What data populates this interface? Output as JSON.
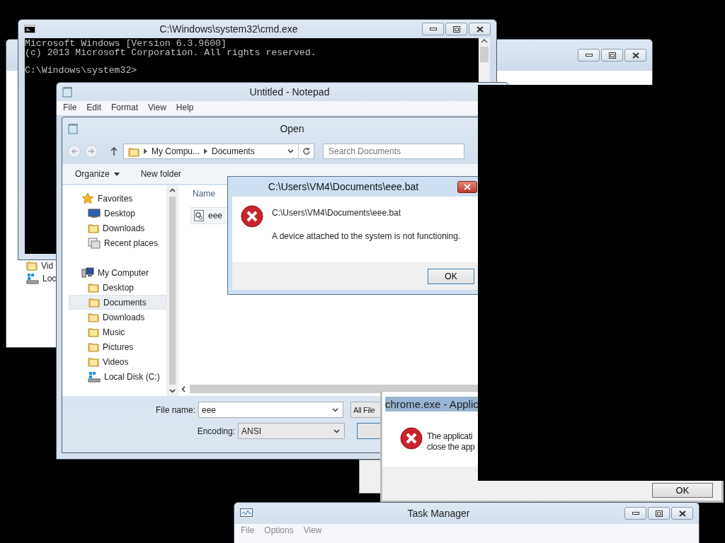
{
  "back_window": {
    "items": [
      "Vid",
      "Loc"
    ]
  },
  "cmd_window": {
    "title": "C:\\Windows\\system32\\cmd.exe",
    "lines": [
      "Microsoft Windows [Version 6.3.9600]",
      "(c) 2013 Microsoft Corporation. All rights reserved."
    ],
    "prompt": "C:\\Windows\\system32>"
  },
  "notepad": {
    "title": "Untitled - Notepad",
    "menu": [
      "File",
      "Edit",
      "Format",
      "View",
      "Help"
    ]
  },
  "open_dialog": {
    "title": "Open",
    "breadcrumb": [
      "My Compu...",
      "Documents"
    ],
    "search": {
      "placeholder": "Search Documents"
    },
    "toolbar": [
      "Organize",
      "New folder"
    ],
    "nav_tree": [
      {
        "label": "Favorites",
        "selected": false,
        "children": [
          {
            "label": "Desktop",
            "selected": false
          },
          {
            "label": "Downloads",
            "selected": false
          },
          {
            "label": "Recent places",
            "selected": false
          }
        ]
      },
      {
        "label": "My Computer",
        "selected": false,
        "children": [
          {
            "label": "Desktop",
            "selected": false
          },
          {
            "label": "Documents",
            "selected": true
          },
          {
            "label": "Downloads",
            "selected": false
          },
          {
            "label": "Music",
            "selected": false
          },
          {
            "label": "Pictures",
            "selected": false
          },
          {
            "label": "Videos",
            "selected": false
          },
          {
            "label": "Local Disk (C:)",
            "selected": false
          }
        ]
      }
    ],
    "column": "Name",
    "files": [
      "eee"
    ],
    "file_name_label": "File name:",
    "file_name": "eee",
    "file_type": "All File",
    "encoding_label": "Encoding:",
    "encoding": "ANSI"
  },
  "error_dialog": {
    "title": "C:\\Users\\VM4\\Documents\\eee.bat",
    "path": "C:\\Users\\VM4\\Documents\\eee.bat",
    "message": "A device attached to the system is not functioning.",
    "button": "OK"
  },
  "chrome_dialog": {
    "title": "chrome.exe - Applic",
    "lines": [
      "The applicati",
      "close the app"
    ],
    "button": "OK"
  },
  "task_manager": {
    "title": "Task Manager",
    "menu": [
      "File",
      "Options",
      "View"
    ]
  }
}
